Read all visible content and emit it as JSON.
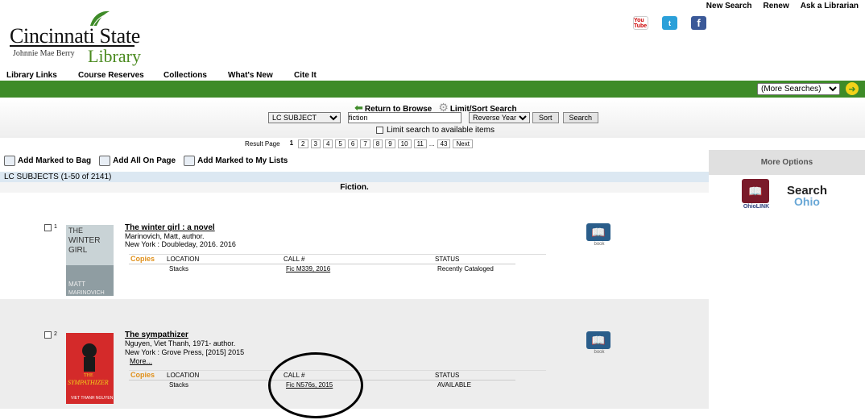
{
  "logo": {
    "name": "Cincinnati State",
    "sub": "Johnnie Mae Berry",
    "library": "Library"
  },
  "toplinks": [
    "New Search",
    "Renew",
    "Ask a Librarian"
  ],
  "social": {
    "youtube": "You Tube",
    "twitter": "t",
    "facebook": "f"
  },
  "nav": [
    "Library Links",
    "Course Reserves",
    "Collections",
    "What's New",
    "Cite It"
  ],
  "more_searches": "(More Searches)",
  "search": {
    "return_label": "Return to Browse",
    "limit_sort_label": "Limit/Sort Search",
    "type_value": "LC SUBJECT",
    "query_value": "fiction",
    "sort_value": "Reverse Year",
    "sort_button": "Sort",
    "search_button": "Search",
    "limit_label": "Limit search to available items"
  },
  "pager": {
    "label": "Result Page",
    "current": "1",
    "pages": [
      "2",
      "3",
      "4",
      "5",
      "6",
      "7",
      "8",
      "9",
      "10",
      "11"
    ],
    "ellipsis": "...",
    "last": "43",
    "next": "Next"
  },
  "actions": {
    "add_marked_bag": "Add Marked to Bag",
    "add_all_page": "Add All On Page",
    "add_marked_lists": "Add Marked to My Lists"
  },
  "subject_bar": "LC SUBJECTS (1-50 of 2141)",
  "heading": "Fiction.",
  "holdings_headers": {
    "copies": "Copies",
    "location": "LOCATION",
    "call": "CALL #",
    "status": "STATUS"
  },
  "records": [
    {
      "num": "1",
      "title": "The winter girl : a novel",
      "author": "Marinovich, Matt, author.",
      "pub": "New York : Doubleday, 2016. 2016",
      "location": "Stacks",
      "call": "Fic M339, 2016",
      "status": "Recently Cataloged",
      "type": "book",
      "cover_text": [
        "THE",
        "WINTER",
        "GIRL",
        "MATT",
        "MARINOVICH"
      ]
    },
    {
      "num": "2",
      "title": "The sympathizer",
      "author": "Nguyen, Viet Thanh, 1971- author.",
      "pub": "New York : Grove Press, [2015] 2015",
      "more": "More...",
      "location": "Stacks",
      "call": "Fic N576s, 2015",
      "status": "AVAILABLE",
      "type": "book",
      "cover_text": [
        "THE",
        "SYMPATHIZER",
        "VIET THANH NGUYEN"
      ]
    }
  ],
  "right_panel": {
    "header": "More Options",
    "ohiolink": "OhioLINK",
    "search_ohio_1": "Search",
    "search_ohio_2": "Ohio"
  },
  "colors": {
    "green_bar": "#3e8b28",
    "copies_orange": "#e0901a",
    "subject_bar": "#dce8f2"
  }
}
